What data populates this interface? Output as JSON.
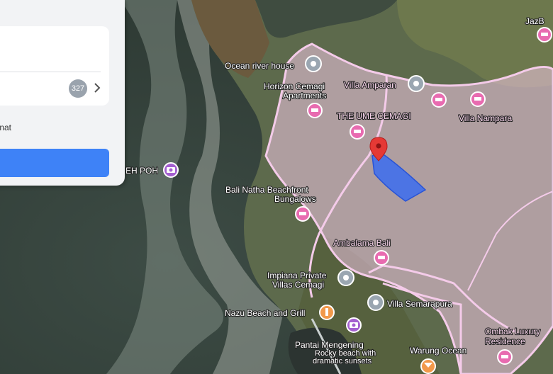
{
  "panel": {
    "count_badge": "327",
    "coordinate_text": "rdinat",
    "chevron_icon": "chevron-right-icon"
  },
  "labels": {
    "ocean_river_house": "Ocean river house",
    "horizon_1": "Horizon Cemagi",
    "horizon_2": "Apartments",
    "villa_amparan": "Villa Amparan",
    "the_ume": "THE UME CEMAGI",
    "villa_nampara": "Villa Nampara",
    "jazb": "JazB",
    "eh_poh": "EH POH",
    "bali_natha_1": "Bali Natha Beachfront",
    "bali_natha_2": "Bungalows",
    "ambalama": "Ambalama Bali",
    "impiana_1": "Impiana Private",
    "impiana_2": "Villas Cemagi",
    "nazu": "Nazu Beach and Grill",
    "villa_semarapura": "Villa Semarapura",
    "pantai": "Pantai Mengening",
    "rocky_1": "Rocky beach with",
    "rocky_2": "dramatic sunsets",
    "warung": "Warung Ocean",
    "ombak_1": "Ombak Luxury",
    "ombak_2": "Residence"
  },
  "colors": {
    "boundary": "#f2c8e6",
    "parcel": "#3b6cf0",
    "marker": "#e53935",
    "hotel_pin": "#e86bb0",
    "camera_pin": "#a45fd0",
    "food_pin": "#f2994a",
    "generic_pin": "#9aa6b1",
    "button": "#3e82f7"
  }
}
